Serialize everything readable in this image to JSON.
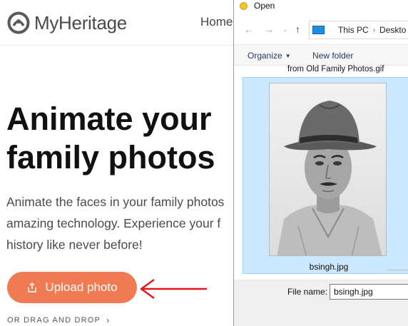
{
  "site": {
    "logo_text": "MyHeritage",
    "nav_home": "Home",
    "hero_title_line1": "Animate your",
    "hero_title_line2": "family photos",
    "desc_line1": "Animate the faces in your family photos",
    "desc_line2": "amazing technology. Experience your f",
    "desc_line3": "history like never before!",
    "upload_label": "Upload photo",
    "drag_drop_label": "OR DRAG AND DROP",
    "accent_color": "#f07a52",
    "annotation_arrow_color": "#e0191e"
  },
  "dialog": {
    "title": "Open",
    "breadcrumb_1": "This PC",
    "breadcrumb_2": "Deskto",
    "organize_label": "Organize",
    "new_folder_label": "New folder",
    "partial_file_name": "from Old Family Photos.gif",
    "selected_file_label": "bsingh.jpg",
    "file_name_label": "File name:",
    "file_name_value": "bsingh.jpg",
    "selection_color": "#cce8ff"
  }
}
